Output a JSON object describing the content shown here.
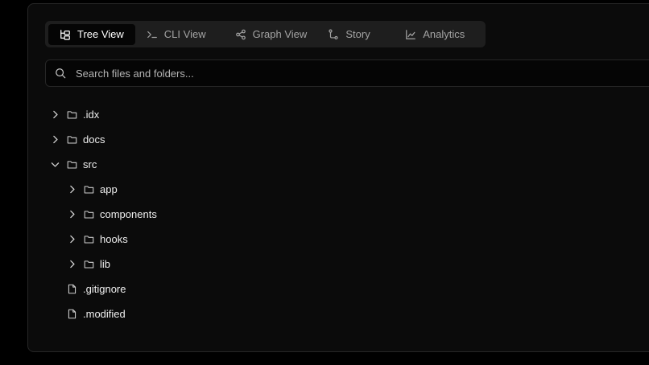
{
  "tabs": [
    {
      "label": "Tree View",
      "icon": "tree-icon",
      "active": true
    },
    {
      "label": "CLI View",
      "icon": "terminal-icon",
      "active": false
    },
    {
      "label": "Graph View",
      "icon": "share-nodes-icon",
      "active": false
    },
    {
      "label": "Story",
      "icon": "git-branch-icon",
      "active": false
    },
    {
      "label": "Analytics",
      "icon": "chart-icon",
      "active": false
    }
  ],
  "search": {
    "placeholder": "Search files and folders...",
    "value": ""
  },
  "tree": [
    {
      "name": ".idx",
      "type": "folder",
      "expanded": false,
      "depth": 0
    },
    {
      "name": "docs",
      "type": "folder",
      "expanded": false,
      "depth": 0
    },
    {
      "name": "src",
      "type": "folder",
      "expanded": true,
      "depth": 0
    },
    {
      "name": "app",
      "type": "folder",
      "expanded": false,
      "depth": 1
    },
    {
      "name": "components",
      "type": "folder",
      "expanded": false,
      "depth": 1
    },
    {
      "name": "hooks",
      "type": "folder",
      "expanded": false,
      "depth": 1
    },
    {
      "name": "lib",
      "type": "folder",
      "expanded": false,
      "depth": 1
    },
    {
      "name": ".gitignore",
      "type": "file",
      "depth": 0
    },
    {
      "name": ".modified",
      "type": "file",
      "depth": 0
    }
  ],
  "colors": {
    "background": "#000000",
    "panel": "#0b0b0b",
    "tabbar": "#1e1e1e",
    "active_tab": "#050505",
    "text": "#f0f0f0",
    "muted_text": "#a3a3a3"
  }
}
